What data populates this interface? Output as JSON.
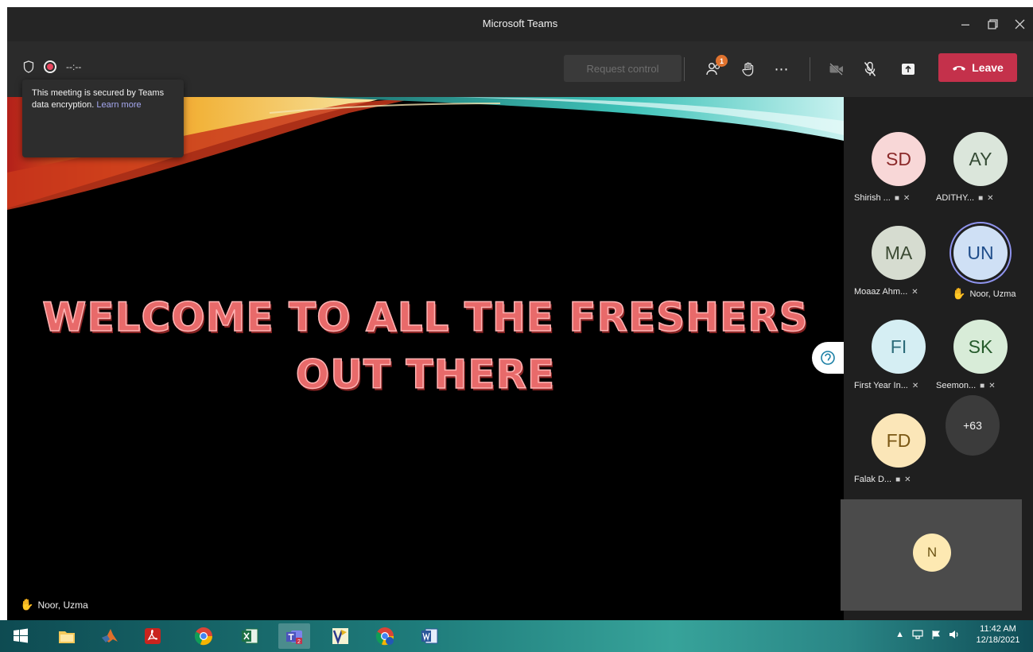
{
  "window": {
    "title": "Microsoft Teams"
  },
  "toolbar": {
    "timer": "--:--",
    "request_control": "Request control",
    "participants_badge": "1",
    "leave_label": "Leave"
  },
  "tooltip": {
    "text": "This meeting is secured by Teams data encryption.",
    "link": "Learn more"
  },
  "slide": {
    "line1": "WELCOME TO ALL THE FRESHERS",
    "line2": "OUT THERE"
  },
  "presenter": {
    "name": "Noor, Uzma",
    "icon": "raised-hand-icon"
  },
  "participants": [
    {
      "initials": "SD",
      "name": "Shirish ...",
      "bg": "#f8d7d7",
      "fg": "#8b2a2a",
      "icons": [
        "video-off-icon",
        "mic-off-icon"
      ]
    },
    {
      "initials": "AY",
      "name": "ADITHY...",
      "bg": "#dbe6db",
      "fg": "#344a34",
      "icons": [
        "video-off-icon",
        "mic-off-icon"
      ]
    },
    {
      "initials": "MA",
      "name": "Moaaz Ahm...",
      "bg": "#d6dcd0",
      "fg": "#3b4a33",
      "icons": [
        "mic-off-icon"
      ]
    },
    {
      "initials": "UN",
      "name": "Noor, Uzma",
      "bg": "#cfe0f5",
      "fg": "#1f4d8a",
      "icons": [
        "raised-hand-icon"
      ]
    },
    {
      "initials": "FI",
      "name": "First Year In...",
      "bg": "#d5eef3",
      "fg": "#2b6a78",
      "icons": [
        "mic-off-icon"
      ]
    },
    {
      "initials": "SK",
      "name": "Seemon...",
      "bg": "#d8ecd8",
      "fg": "#255a2b",
      "icons": [
        "video-off-icon",
        "mic-off-icon"
      ]
    },
    {
      "initials": "FD",
      "name": "Falak D...",
      "bg": "#fbe6b8",
      "fg": "#7a5714",
      "icons": [
        "video-off-icon",
        "mic-off-icon"
      ]
    }
  ],
  "more_participants": "+63",
  "self_view": {
    "initials": "N"
  },
  "taskbar": {
    "apps": [
      "start-icon",
      "file-explorer-icon",
      "matlab-icon",
      "acrobat-icon",
      "chrome-icon",
      "excel-icon",
      "teams-icon",
      "visio-icon",
      "chrome-profile-icon",
      "word-icon"
    ],
    "time": "11:42 AM",
    "date": "12/18/2021"
  },
  "colors": {
    "leave": "#c4314b",
    "badge": "#e0732f",
    "accent": "#a5a8f0"
  }
}
